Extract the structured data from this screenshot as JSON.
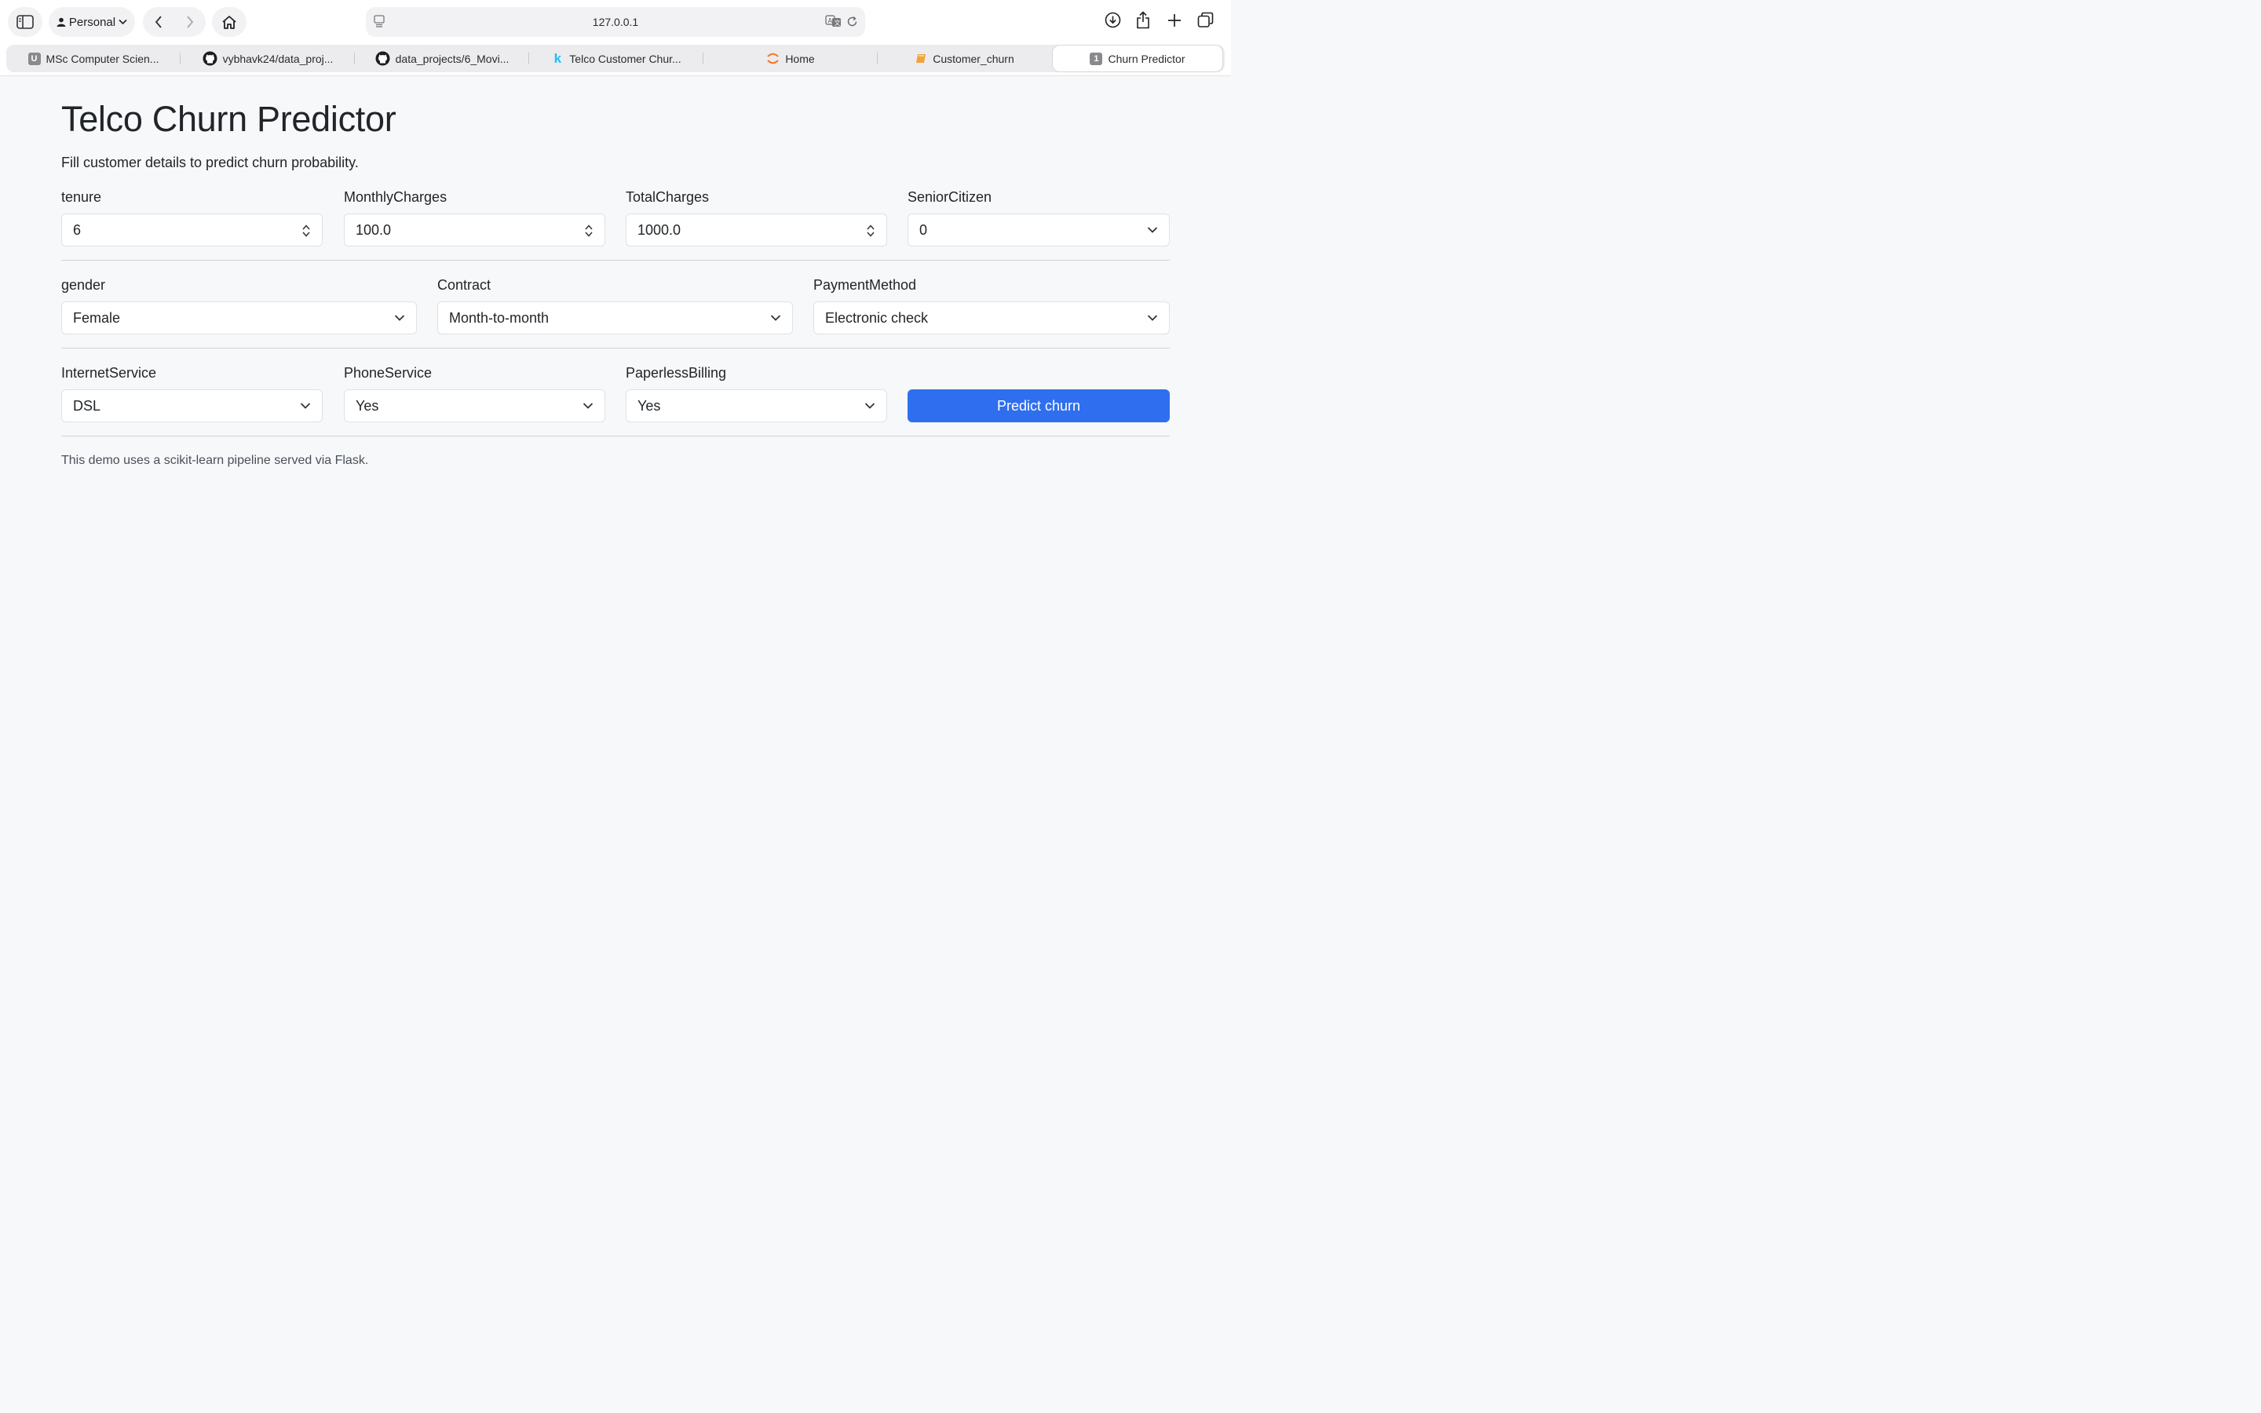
{
  "browser": {
    "profile_label": "Personal",
    "url": "127.0.0.1",
    "tabs": [
      {
        "label": "MSc Computer Scien...",
        "icon": "university-icon",
        "fav_text": "U"
      },
      {
        "label": "vybhavk24/data_proj...",
        "icon": "github-icon"
      },
      {
        "label": "data_projects/6_Movi...",
        "icon": "github-icon"
      },
      {
        "label": "Telco Customer Chur...",
        "icon": "kaggle-icon",
        "fav_text": "k"
      },
      {
        "label": "Home",
        "icon": "jupyter-icon"
      },
      {
        "label": "Customer_churn",
        "icon": "notebook-icon"
      },
      {
        "label": "Churn Predictor",
        "icon": "tab-number-icon",
        "fav_text": "1",
        "active": true
      }
    ]
  },
  "page": {
    "title": "Telco Churn Predictor",
    "subtitle": "Fill customer details to predict churn probability.",
    "row1": {
      "tenure": {
        "label": "tenure",
        "value": "6"
      },
      "monthly": {
        "label": "MonthlyCharges",
        "value": "100.0"
      },
      "total": {
        "label": "TotalCharges",
        "value": "1000.0"
      },
      "senior": {
        "label": "SeniorCitizen",
        "value": "0"
      }
    },
    "row2": {
      "gender": {
        "label": "gender",
        "value": "Female"
      },
      "contract": {
        "label": "Contract",
        "value": "Month-to-month"
      },
      "payment": {
        "label": "PaymentMethod",
        "value": "Electronic check"
      }
    },
    "row3": {
      "internet": {
        "label": "InternetService",
        "value": "DSL"
      },
      "phone": {
        "label": "PhoneService",
        "value": "Yes"
      },
      "paperless": {
        "label": "PaperlessBilling",
        "value": "Yes"
      },
      "submit_label": "Predict churn"
    },
    "footer": "This demo uses a scikit-learn pipeline served via Flask."
  },
  "colors": {
    "primary": "#2f6fef",
    "background": "#f7f8fa"
  }
}
